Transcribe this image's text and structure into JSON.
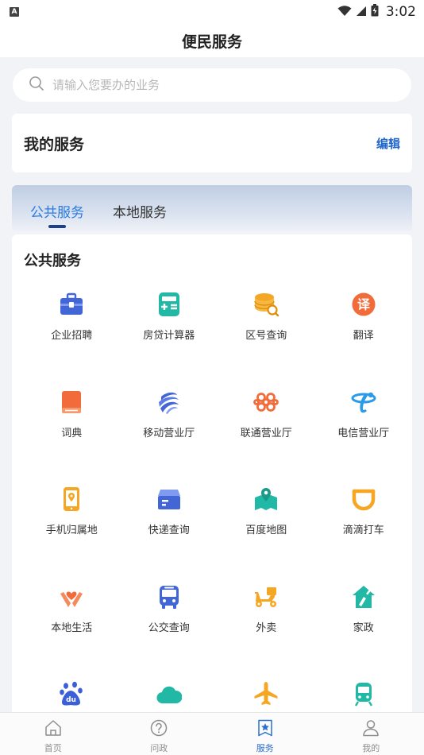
{
  "status_bar": {
    "notification_badge": "A",
    "time": "3:02",
    "icons": [
      "wifi-icon",
      "signal-icon",
      "battery-icon"
    ]
  },
  "header": {
    "title": "便民服务"
  },
  "search": {
    "placeholder": "请输入您要办的业务"
  },
  "my_service": {
    "title": "我的服务",
    "edit_label": "编辑"
  },
  "tabs": [
    {
      "label": "公共服务",
      "active": true
    },
    {
      "label": "本地服务",
      "active": false
    }
  ],
  "public_services": {
    "title": "公共服务",
    "items": [
      {
        "label": "企业招聘",
        "icon": "briefcase-icon"
      },
      {
        "label": "房贷计算器",
        "icon": "calculator-icon"
      },
      {
        "label": "区号查询",
        "icon": "coins-search-icon"
      },
      {
        "label": "翻译",
        "icon": "translate-icon"
      },
      {
        "label": "词典",
        "icon": "dictionary-icon"
      },
      {
        "label": "移动营业厅",
        "icon": "china-mobile-icon"
      },
      {
        "label": "联通营业厅",
        "icon": "china-unicom-icon"
      },
      {
        "label": "电信营业厅",
        "icon": "china-telecom-icon"
      },
      {
        "label": "手机归属地",
        "icon": "phone-location-icon"
      },
      {
        "label": "快递查询",
        "icon": "package-icon"
      },
      {
        "label": "百度地图",
        "icon": "map-icon"
      },
      {
        "label": "滴滴打车",
        "icon": "didi-icon"
      },
      {
        "label": "本地生活",
        "icon": "hands-heart-icon"
      },
      {
        "label": "公交查询",
        "icon": "bus-icon"
      },
      {
        "label": "外卖",
        "icon": "scooter-icon"
      },
      {
        "label": "家政",
        "icon": "house-broom-icon"
      },
      {
        "label": "",
        "icon": "baidu-paw-icon"
      },
      {
        "label": "",
        "icon": "cloud-icon"
      },
      {
        "label": "",
        "icon": "airplane-icon"
      },
      {
        "label": "",
        "icon": "train-icon"
      }
    ]
  },
  "bottom_nav": [
    {
      "label": "首页",
      "icon": "home-icon",
      "active": false
    },
    {
      "label": "问政",
      "icon": "question-circle-icon",
      "active": false
    },
    {
      "label": "服务",
      "icon": "service-star-icon",
      "active": true
    },
    {
      "label": "我的",
      "icon": "user-icon",
      "active": false
    }
  ],
  "colors": {
    "accent": "#2b7be0",
    "edit_link": "#2167c9",
    "tab_underline": "#1d3f8c",
    "page_background": "#f2f3f7"
  }
}
